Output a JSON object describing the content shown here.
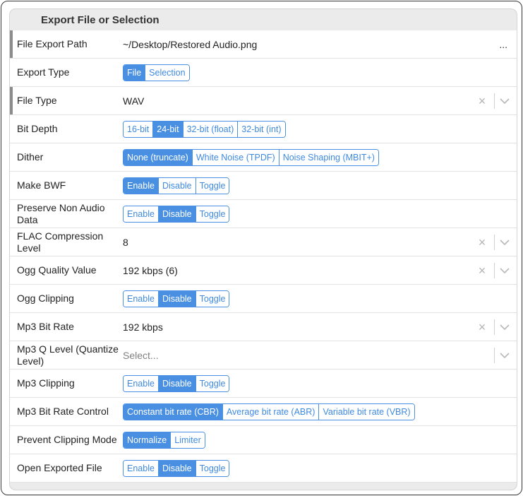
{
  "panel": {
    "title": "Export File or Selection"
  },
  "rows": {
    "file_export_path": {
      "label": "File Export Path",
      "value": "~/Desktop/Restored Audio.png",
      "browse": "..."
    },
    "export_type": {
      "label": "Export Type",
      "options": [
        "File",
        "Selection"
      ],
      "selected": "File"
    },
    "file_type": {
      "label": "File Type",
      "value": "WAV"
    },
    "bit_depth": {
      "label": "Bit Depth",
      "options": [
        "16-bit",
        "24-bit",
        "32-bit (float)",
        "32-bit (int)"
      ],
      "selected": "24-bit"
    },
    "dither": {
      "label": "Dither",
      "options": [
        "None (truncate)",
        "White Noise (TPDF)",
        "Noise Shaping (MBIT+)"
      ],
      "selected": "None (truncate)"
    },
    "make_bwf": {
      "label": "Make BWF",
      "options": [
        "Enable",
        "Disable",
        "Toggle"
      ],
      "selected": "Enable"
    },
    "preserve_non_audio": {
      "label": "Preserve Non Audio Data",
      "options": [
        "Enable",
        "Disable",
        "Toggle"
      ],
      "selected": "Disable"
    },
    "flac_compression": {
      "label": "FLAC Compression Level",
      "value": "8"
    },
    "ogg_quality": {
      "label": "Ogg Quality Value",
      "value": "192 kbps (6)"
    },
    "ogg_clipping": {
      "label": "Ogg Clipping",
      "options": [
        "Enable",
        "Disable",
        "Toggle"
      ],
      "selected": "Disable"
    },
    "mp3_bit_rate": {
      "label": "Mp3 Bit Rate",
      "value": "192 kbps"
    },
    "mp3_q_level": {
      "label": "Mp3 Q Level (Quantize Level)",
      "placeholder": "Select..."
    },
    "mp3_clipping": {
      "label": "Mp3 Clipping",
      "options": [
        "Enable",
        "Disable",
        "Toggle"
      ],
      "selected": "Disable"
    },
    "mp3_bit_rate_control": {
      "label": "Mp3 Bit Rate Control",
      "options": [
        "Constant bit rate (CBR)",
        "Average bit rate (ABR)",
        "Variable bit rate (VBR)"
      ],
      "selected": "Constant bit rate (CBR)"
    },
    "prevent_clipping": {
      "label": "Prevent Clipping Mode",
      "options": [
        "Normalize",
        "Limiter"
      ],
      "selected": "Normalize"
    },
    "open_exported": {
      "label": "Open Exported File",
      "options": [
        "Enable",
        "Disable",
        "Toggle"
      ],
      "selected": "Disable"
    }
  },
  "icons": {
    "clear": "close-x-icon",
    "dropdown": "chevron-down-icon"
  },
  "colors": {
    "accent": "#4a90e2",
    "row_marker": "#8c8c8c",
    "panel_bg": "#ebebeb"
  }
}
